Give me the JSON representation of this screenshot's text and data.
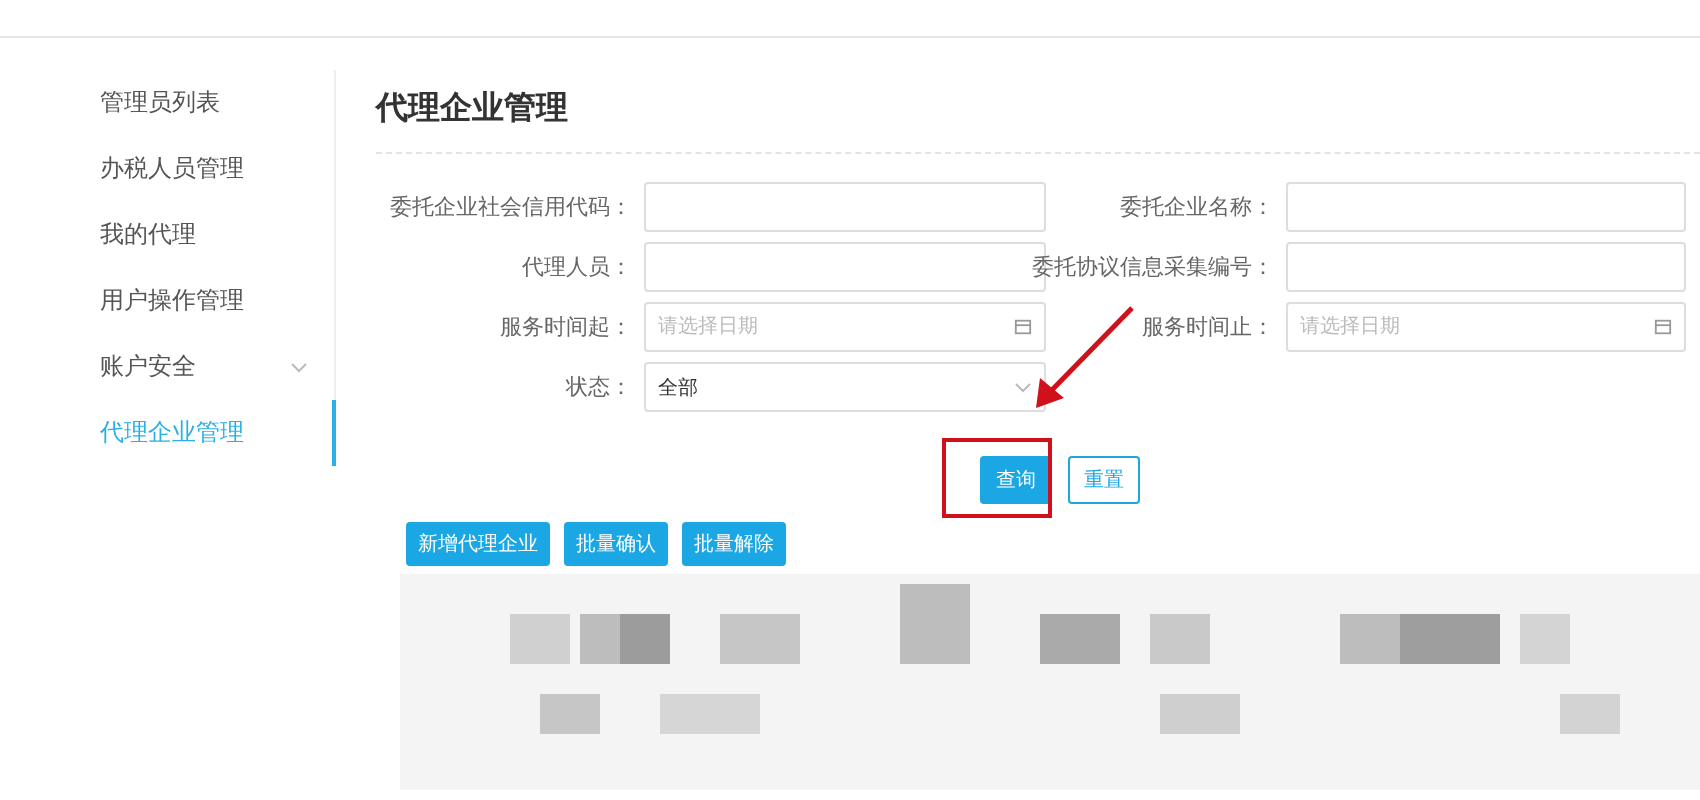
{
  "sidebar": {
    "items": [
      {
        "label": "管理员列表",
        "kind": "link",
        "selected": false
      },
      {
        "label": "办税人员管理",
        "kind": "link",
        "selected": false
      },
      {
        "label": "我的代理",
        "kind": "link",
        "selected": false
      },
      {
        "label": "用户操作管理",
        "kind": "link",
        "selected": false
      },
      {
        "label": "账户安全",
        "kind": "group",
        "selected": false
      },
      {
        "label": "代理企业管理",
        "kind": "link",
        "selected": true
      }
    ]
  },
  "title": "代理企业管理",
  "form": {
    "fields": [
      {
        "label": "委托企业社会信用代码：",
        "kind": "text"
      },
      {
        "label": "委托企业名称：",
        "kind": "text"
      },
      {
        "label": "代理人员：",
        "kind": "text"
      },
      {
        "label": "委托协议信息采集编号：",
        "kind": "text"
      },
      {
        "label": "服务时间起：",
        "kind": "date",
        "placeholder": "请选择日期"
      },
      {
        "label": "服务时间止：",
        "kind": "date",
        "placeholder": "请选择日期"
      },
      {
        "label": "状态：",
        "kind": "select",
        "value": "全部"
      }
    ]
  },
  "actions": [
    {
      "label": "查询",
      "kind": "primary"
    },
    {
      "label": "重置",
      "kind": "secondary"
    }
  ],
  "toolbar": [
    "新增代理企业",
    "批量确认",
    "批量解除"
  ],
  "annotations": {
    "highlight": true,
    "arrow": true
  }
}
